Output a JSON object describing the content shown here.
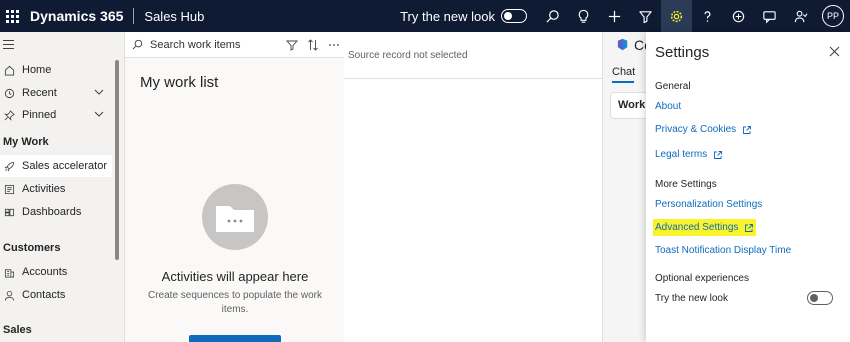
{
  "topbar": {
    "brand": "Dynamics 365",
    "app_name": "Sales Hub",
    "try_new_look": "Try the new look",
    "avatar_initials": "PP",
    "icons": [
      "search-icon",
      "lightbulb-icon",
      "plus-icon",
      "filter-icon",
      "gear-icon",
      "help-icon",
      "copilot-icon",
      "chat-icon",
      "people-icon"
    ]
  },
  "leftnav": {
    "items": [
      {
        "label": "Home",
        "icon": "home-icon"
      },
      {
        "label": "Recent",
        "icon": "clock-icon"
      },
      {
        "label": "Pinned",
        "icon": "pin-icon"
      }
    ],
    "section_my_work": "My Work",
    "my_work_items": [
      {
        "label": "Sales accelerator",
        "icon": "rocket-icon"
      },
      {
        "label": "Activities",
        "icon": "activity-icon"
      },
      {
        "label": "Dashboards",
        "icon": "dashboard-icon"
      }
    ],
    "section_customers": "Customers",
    "customer_items": [
      {
        "label": "Accounts",
        "icon": "building-icon"
      },
      {
        "label": "Contacts",
        "icon": "person-icon"
      }
    ],
    "section_sales": "Sales"
  },
  "worklist": {
    "search_placeholder": "Search work items",
    "title": "My work list",
    "empty_title": "Activities will appear here",
    "empty_subtitle": "Create sequences to populate the work items."
  },
  "main": {
    "source_record": "Source record not selected"
  },
  "copilot": {
    "title": "Co",
    "tab": "Chat",
    "card": "Workin"
  },
  "settings": {
    "title": "Settings",
    "general_heading": "General",
    "about": "About",
    "privacy": "Privacy & Cookies",
    "legal": "Legal terms",
    "more_heading": "More Settings",
    "personalization": "Personalization Settings",
    "advanced": "Advanced Settings",
    "toast": "Toast Notification Display Time",
    "optional_heading": "Optional experiences",
    "try_new_look": "Try the new look",
    "highlight_color": "#f8f32b",
    "link_color": "#0f6cbd"
  }
}
